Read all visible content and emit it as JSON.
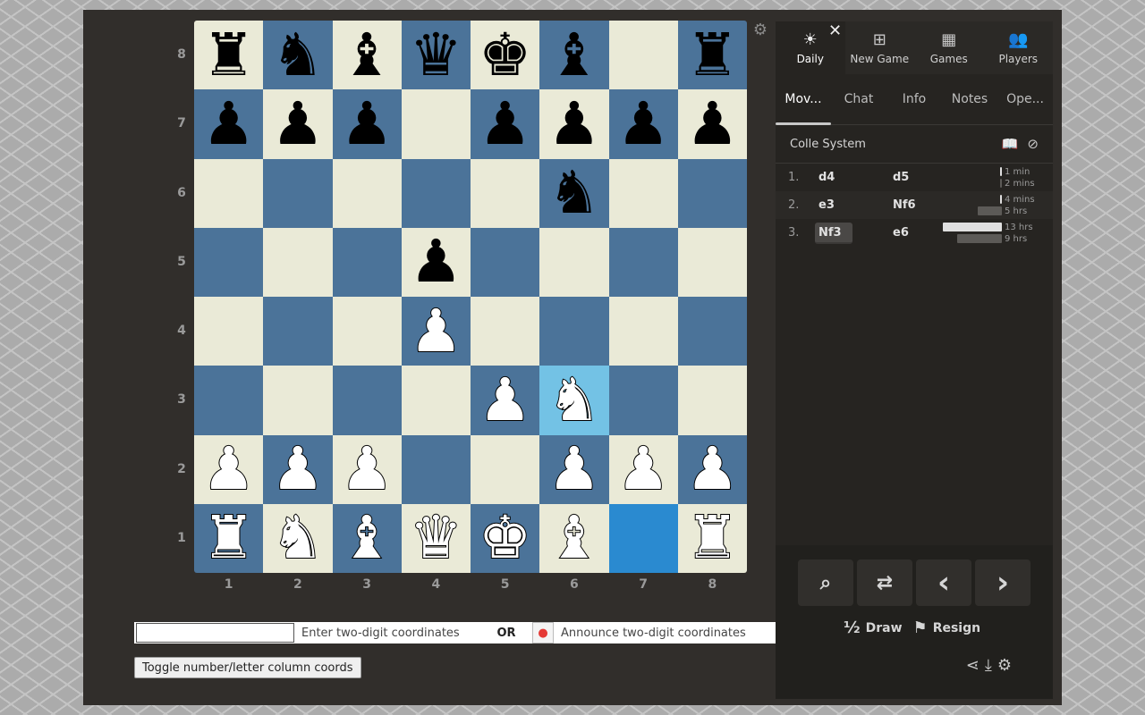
{
  "board": {
    "rank_labels": [
      "8",
      "7",
      "6",
      "5",
      "4",
      "3",
      "2",
      "1"
    ],
    "file_labels": [
      "1",
      "2",
      "3",
      "4",
      "5",
      "6",
      "7",
      "8"
    ],
    "colors": {
      "light": "#eaead7",
      "dark": "#4b7399",
      "highlight_from": "#2a8ad0",
      "highlight_to": "#73c2e5"
    },
    "position": [
      [
        "r",
        "n",
        "b",
        "q",
        "k",
        "b",
        "",
        "r"
      ],
      [
        "p",
        "p",
        "p",
        "",
        "p",
        "p",
        "p",
        "p"
      ],
      [
        "",
        "",
        "",
        "",
        "",
        "n",
        "",
        ""
      ],
      [
        "",
        "",
        "",
        "p",
        "",
        "",
        "",
        ""
      ],
      [
        "",
        "",
        "",
        "P",
        "",
        "",
        "",
        ""
      ],
      [
        "",
        "",
        "",
        "",
        "P",
        "N",
        "",
        ""
      ],
      [
        "P",
        "P",
        "P",
        "",
        "",
        "P",
        "P",
        "P"
      ],
      [
        "R",
        "N",
        "B",
        "Q",
        "K",
        "B",
        "",
        "R"
      ]
    ],
    "highlight_from": "g1",
    "highlight_to": "f3",
    "settings_icon": "gear-icon"
  },
  "nav": {
    "close_label": "✕",
    "items": [
      {
        "label": "Daily",
        "icon": "☀",
        "active": true
      },
      {
        "label": "New Game",
        "icon": "⊞",
        "active": false
      },
      {
        "label": "Games",
        "icon": "▦",
        "active": false
      },
      {
        "label": "Players",
        "icon": "👥",
        "active": false
      }
    ]
  },
  "tabs": [
    {
      "label": "Mov...",
      "active": true
    },
    {
      "label": "Chat",
      "active": false
    },
    {
      "label": "Info",
      "active": false
    },
    {
      "label": "Notes",
      "active": false
    },
    {
      "label": "Ope...",
      "active": false
    }
  ],
  "opening": {
    "name": "Colle System"
  },
  "moves": [
    {
      "num": "1.",
      "white": "d4",
      "black": "d5",
      "white_time": "1 min",
      "black_time": "2 mins",
      "white_bar": 0.0,
      "black_bar": 0.0
    },
    {
      "num": "2.",
      "white": "e3",
      "black": "Nf6",
      "white_time": "4 mins",
      "black_time": "5 hrs",
      "white_bar": 0.0,
      "black_bar": 0.38
    },
    {
      "num": "3.",
      "white": "Nf3",
      "black": "e6",
      "white_time": "13 hrs",
      "black_time": "9 hrs",
      "white_bar": 1.0,
      "black_bar": 0.69
    }
  ],
  "current_move": "Nf3",
  "controls": {
    "buttons": [
      {
        "name": "analysis-button",
        "icon": "⌕"
      },
      {
        "name": "flip-board-button",
        "icon": "⇄"
      },
      {
        "name": "previous-move-button",
        "icon": "‹"
      },
      {
        "name": "next-move-button",
        "icon": "›"
      }
    ],
    "draw_label": "Draw",
    "draw_icon": "½",
    "resign_label": "Resign",
    "resign_icon": "⚑"
  },
  "footer_icons": [
    "share-icon",
    "download-icon",
    "gear-icon"
  ],
  "coord_entry": {
    "input_value": "",
    "hint": "Enter two-digit coordinates",
    "or_label": "OR",
    "announce": "Announce two-digit coordinates",
    "mic_icon": "🎤"
  },
  "toggle_button_label": "Toggle number/letter column coords"
}
